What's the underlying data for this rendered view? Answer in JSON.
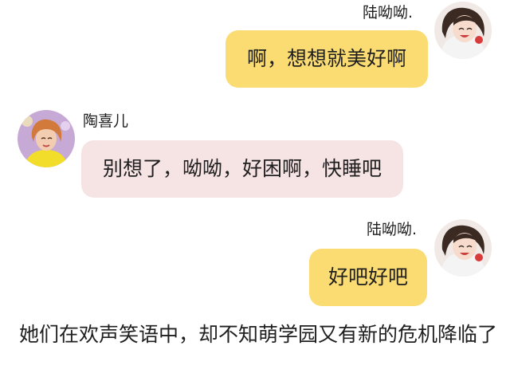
{
  "messages": [
    {
      "side": "right",
      "name": "陆呦呦.",
      "text": "啊，想想就美好啊",
      "avatar_icon": "smiling-girl-avatar-icon"
    },
    {
      "side": "left",
      "name": "陶喜儿",
      "text": "别想了，呦呦，好困啊，快睡吧",
      "avatar_icon": "short-hair-girl-avatar-icon"
    },
    {
      "side": "right",
      "name": "陆呦呦.",
      "text": "好吧好吧",
      "avatar_icon": "smiling-girl-avatar-icon"
    }
  ],
  "narration": "她们在欢声笑语中，却不知萌学园又有新的危机降临了",
  "colors": {
    "right_bubble": "#fbdc73",
    "left_bubble": "#f6e3e4",
    "background": "#ffffff"
  }
}
